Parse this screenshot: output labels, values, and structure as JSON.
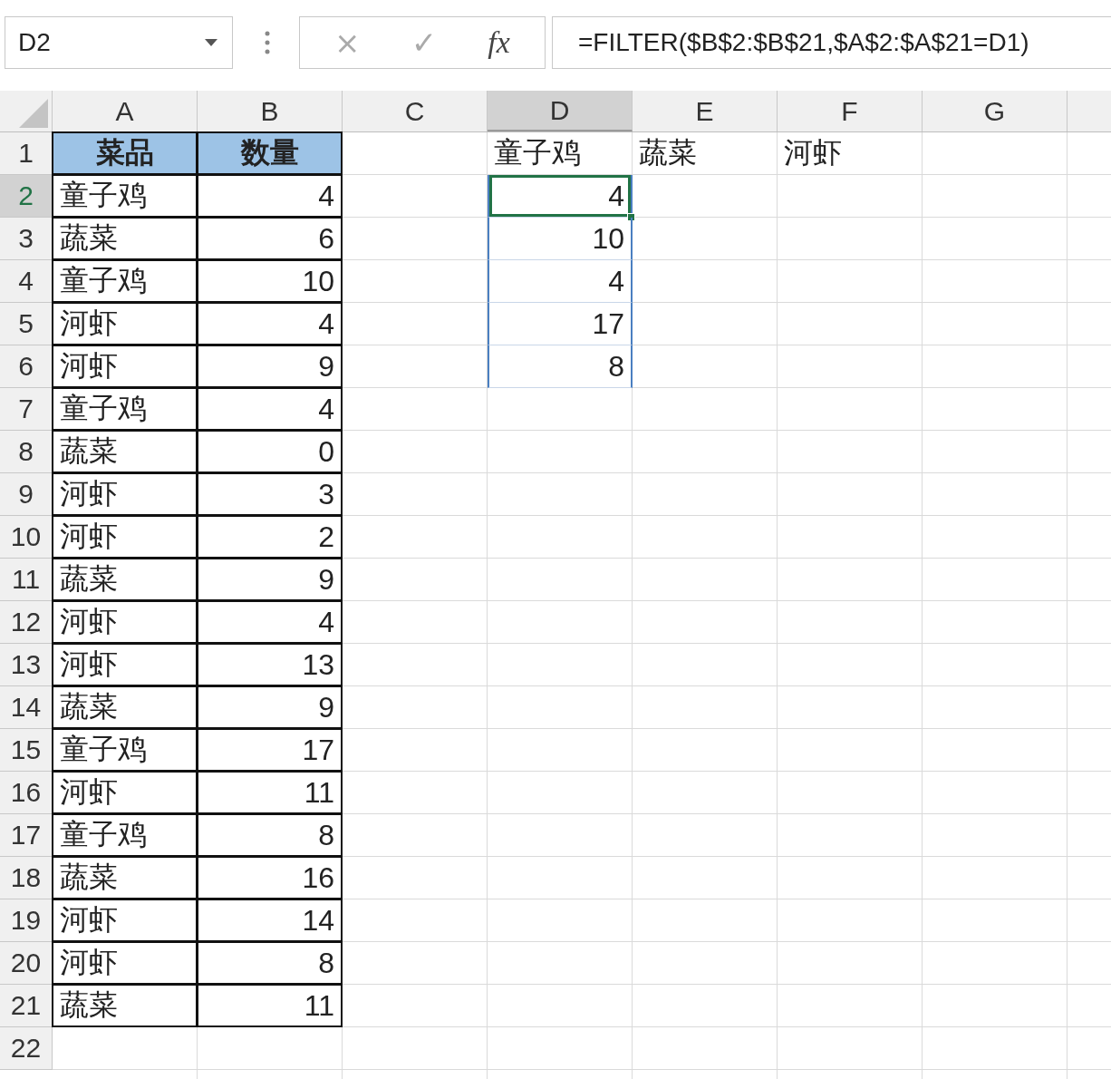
{
  "formula_bar": {
    "name_box": "D2",
    "cancel": "×",
    "enter": "✓",
    "function": "fx",
    "formula": "=FILTER($B$2:$B$21,$A$2:$A$21=D1)"
  },
  "columns": [
    {
      "label": "A",
      "selected": false
    },
    {
      "label": "B",
      "selected": false
    },
    {
      "label": "C",
      "selected": false
    },
    {
      "label": "D",
      "selected": true
    },
    {
      "label": "E",
      "selected": false
    },
    {
      "label": "F",
      "selected": false
    },
    {
      "label": "G",
      "selected": false
    }
  ],
  "rows": [
    {
      "number": "1",
      "selected": false,
      "cells": {
        "A": {
          "text": "菜品",
          "kind": "header",
          "outlined": true
        },
        "B": {
          "text": "数量",
          "kind": "header",
          "outlined": true
        },
        "D": {
          "text": "童子鸡",
          "kind": "text"
        },
        "E": {
          "text": "蔬菜",
          "kind": "text"
        },
        "F": {
          "text": "河虾",
          "kind": "text"
        }
      }
    },
    {
      "number": "2",
      "selected": true,
      "cells": {
        "A": {
          "text": "童子鸡",
          "kind": "text",
          "outlined": true
        },
        "B": {
          "text": "4",
          "kind": "number",
          "outlined": true
        },
        "D": {
          "text": "4",
          "kind": "number",
          "spill": true,
          "active": true
        }
      }
    },
    {
      "number": "3",
      "selected": false,
      "cells": {
        "A": {
          "text": "蔬菜",
          "kind": "text",
          "outlined": true
        },
        "B": {
          "text": "6",
          "kind": "number",
          "outlined": true
        },
        "D": {
          "text": "10",
          "kind": "number",
          "spill": true
        }
      }
    },
    {
      "number": "4",
      "selected": false,
      "cells": {
        "A": {
          "text": "童子鸡",
          "kind": "text",
          "outlined": true
        },
        "B": {
          "text": "10",
          "kind": "number",
          "outlined": true
        },
        "D": {
          "text": "4",
          "kind": "number",
          "spill": true
        }
      }
    },
    {
      "number": "5",
      "selected": false,
      "cells": {
        "A": {
          "text": "河虾",
          "kind": "text",
          "outlined": true
        },
        "B": {
          "text": "4",
          "kind": "number",
          "outlined": true
        },
        "D": {
          "text": "17",
          "kind": "number",
          "spill": true
        }
      }
    },
    {
      "number": "6",
      "selected": false,
      "cells": {
        "A": {
          "text": "河虾",
          "kind": "text",
          "outlined": true
        },
        "B": {
          "text": "9",
          "kind": "number",
          "outlined": true
        },
        "D": {
          "text": "8",
          "kind": "number",
          "spill": true
        }
      }
    },
    {
      "number": "7",
      "selected": false,
      "cells": {
        "A": {
          "text": "童子鸡",
          "kind": "text",
          "outlined": true
        },
        "B": {
          "text": "4",
          "kind": "number",
          "outlined": true
        }
      }
    },
    {
      "number": "8",
      "selected": false,
      "cells": {
        "A": {
          "text": "蔬菜",
          "kind": "text",
          "outlined": true
        },
        "B": {
          "text": "0",
          "kind": "number",
          "outlined": true
        }
      }
    },
    {
      "number": "9",
      "selected": false,
      "cells": {
        "A": {
          "text": "河虾",
          "kind": "text",
          "outlined": true
        },
        "B": {
          "text": "3",
          "kind": "number",
          "outlined": true
        }
      }
    },
    {
      "number": "10",
      "selected": false,
      "cells": {
        "A": {
          "text": "河虾",
          "kind": "text",
          "outlined": true
        },
        "B": {
          "text": "2",
          "kind": "number",
          "outlined": true
        }
      }
    },
    {
      "number": "11",
      "selected": false,
      "cells": {
        "A": {
          "text": "蔬菜",
          "kind": "text",
          "outlined": true
        },
        "B": {
          "text": "9",
          "kind": "number",
          "outlined": true
        }
      }
    },
    {
      "number": "12",
      "selected": false,
      "cells": {
        "A": {
          "text": "河虾",
          "kind": "text",
          "outlined": true
        },
        "B": {
          "text": "4",
          "kind": "number",
          "outlined": true
        }
      }
    },
    {
      "number": "13",
      "selected": false,
      "cells": {
        "A": {
          "text": "河虾",
          "kind": "text",
          "outlined": true
        },
        "B": {
          "text": "13",
          "kind": "number",
          "outlined": true
        }
      }
    },
    {
      "number": "14",
      "selected": false,
      "cells": {
        "A": {
          "text": "蔬菜",
          "kind": "text",
          "outlined": true
        },
        "B": {
          "text": "9",
          "kind": "number",
          "outlined": true
        }
      }
    },
    {
      "number": "15",
      "selected": false,
      "cells": {
        "A": {
          "text": "童子鸡",
          "kind": "text",
          "outlined": true
        },
        "B": {
          "text": "17",
          "kind": "number",
          "outlined": true
        }
      }
    },
    {
      "number": "16",
      "selected": false,
      "cells": {
        "A": {
          "text": "河虾",
          "kind": "text",
          "outlined": true
        },
        "B": {
          "text": "11",
          "kind": "number",
          "outlined": true
        }
      }
    },
    {
      "number": "17",
      "selected": false,
      "cells": {
        "A": {
          "text": "童子鸡",
          "kind": "text",
          "outlined": true
        },
        "B": {
          "text": "8",
          "kind": "number",
          "outlined": true
        }
      }
    },
    {
      "number": "18",
      "selected": false,
      "cells": {
        "A": {
          "text": "蔬菜",
          "kind": "text",
          "outlined": true
        },
        "B": {
          "text": "16",
          "kind": "number",
          "outlined": true
        }
      }
    },
    {
      "number": "19",
      "selected": false,
      "cells": {
        "A": {
          "text": "河虾",
          "kind": "text",
          "outlined": true
        },
        "B": {
          "text": "14",
          "kind": "number",
          "outlined": true
        }
      }
    },
    {
      "number": "20",
      "selected": false,
      "cells": {
        "A": {
          "text": "河虾",
          "kind": "text",
          "outlined": true
        },
        "B": {
          "text": "8",
          "kind": "number",
          "outlined": true
        }
      }
    },
    {
      "number": "21",
      "selected": false,
      "cells": {
        "A": {
          "text": "蔬菜",
          "kind": "text",
          "outlined": true
        },
        "B": {
          "text": "11",
          "kind": "number",
          "outlined": true
        }
      }
    },
    {
      "number": "22",
      "selected": false,
      "cells": {}
    }
  ]
}
